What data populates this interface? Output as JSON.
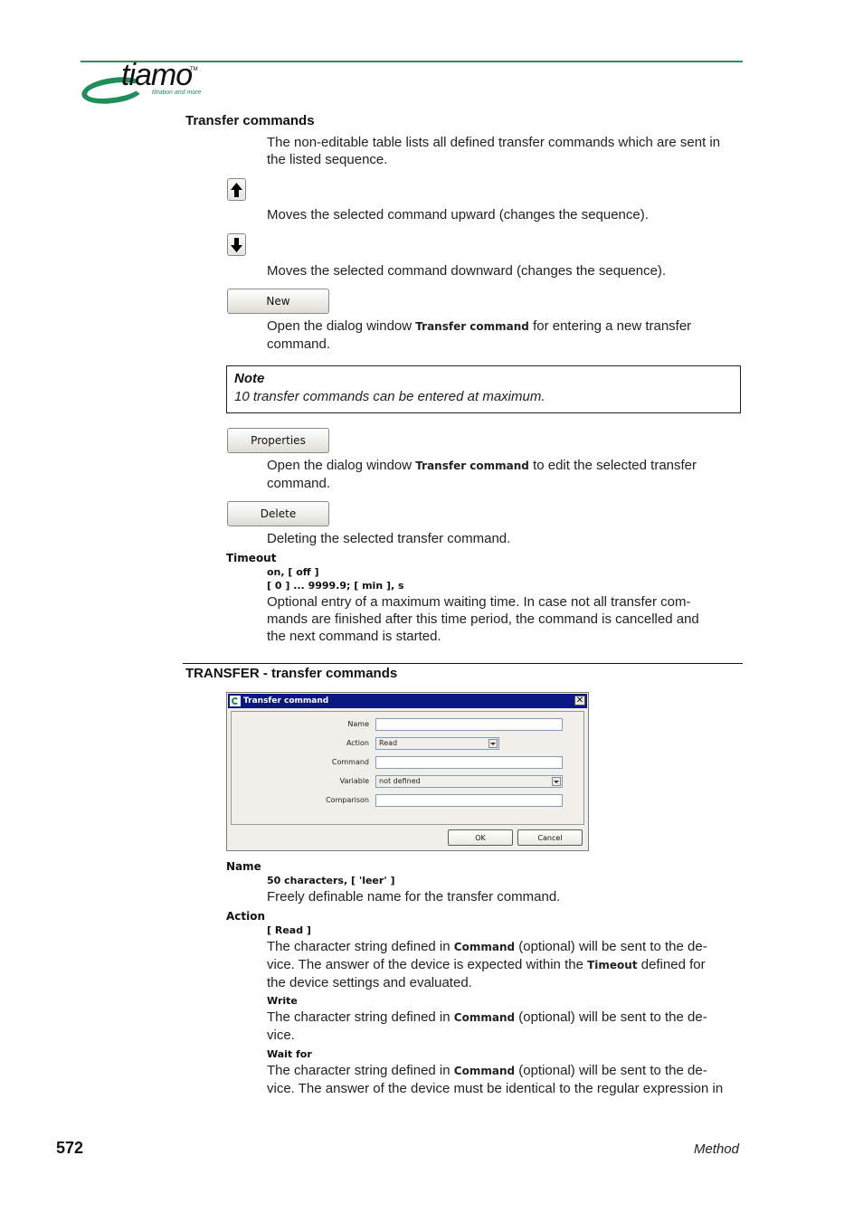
{
  "header": {
    "logo": {
      "wordmark": "tiamo",
      "trademark": "TM",
      "tagline": "titration and more",
      "brand_color": "#1f8f5a"
    },
    "rule_color": "#2e8b62"
  },
  "transfer_commands": {
    "heading": "Transfer commands",
    "intro": [
      "The non-editable table lists all defined transfer commands which are sent in",
      "the listed sequence."
    ],
    "move_up": {
      "icon": "arrow-up-icon",
      "description": "Moves the selected command upward (changes the sequence)."
    },
    "move_down": {
      "icon": "arrow-down-icon",
      "description": "Moves the selected command downward (changes the sequence)."
    },
    "new": {
      "label": "New",
      "desc_prefix": "Open the dialog window ",
      "desc_ref": "Transfer command",
      "desc_suffix": " for entering a new transfer",
      "desc_line2": "command."
    },
    "note": {
      "title": "Note",
      "text": "10 transfer commands can be entered at maximum."
    },
    "properties": {
      "label": "Properties",
      "desc_prefix": "Open the dialog window ",
      "desc_ref": "Transfer command",
      "desc_suffix": " to edit the selected transfer",
      "desc_line2": "command."
    },
    "delete": {
      "label": "Delete",
      "description": "Deleting the selected transfer command."
    }
  },
  "timeout": {
    "label": "Timeout",
    "values1": "on, [ off ]",
    "values2": "[ 0 ] ... 9999.9; [ min ], s",
    "description": [
      "Optional entry of a maximum waiting time. In case not all transfer com-",
      "mands are finished after this time period, the command is cancelled and",
      "the next command is started."
    ]
  },
  "section2": {
    "heading": "TRANSFER - transfer commands"
  },
  "dialog": {
    "title": "Transfer command",
    "close": "✕",
    "fields": [
      {
        "label": "Name",
        "value": ""
      },
      {
        "label": "Action",
        "value": "Read"
      },
      {
        "label": "Command",
        "value": ""
      },
      {
        "label": "Variable",
        "value": "not defined"
      },
      {
        "label": "Comparison",
        "value": ""
      }
    ],
    "ok": "OK",
    "cancel": "Cancel"
  },
  "params": {
    "name": {
      "label": "Name",
      "values": "50 characters, [ 'leer' ]",
      "description": "Freely definable name for the transfer command."
    },
    "action": {
      "label": "Action",
      "read": {
        "value": "[ Read ]",
        "l1_prefix": "The character string defined in ",
        "l1_ref": "Command",
        "l1_suffix": " (optional) will be sent to the de-",
        "l2_prefix": "vice. The answer of the device is expected within the ",
        "l2_ref": "Timeout",
        "l2_suffix": " defined for",
        "l3": "the device settings and evaluated."
      },
      "write": {
        "value": "Write",
        "l1_prefix": "The character string defined in ",
        "l1_ref": "Command",
        "l1_suffix": " (optional) will be sent to the de-",
        "l2": "vice."
      },
      "wait_for": {
        "value": "Wait for",
        "l1_prefix": "The character string defined in ",
        "l1_ref": "Command",
        "l1_suffix": " (optional) will be sent to the de-",
        "l2": "vice. The answer of the device must be identical to the regular expression in"
      }
    }
  },
  "footer": {
    "page_number": "572",
    "section": "Method"
  }
}
